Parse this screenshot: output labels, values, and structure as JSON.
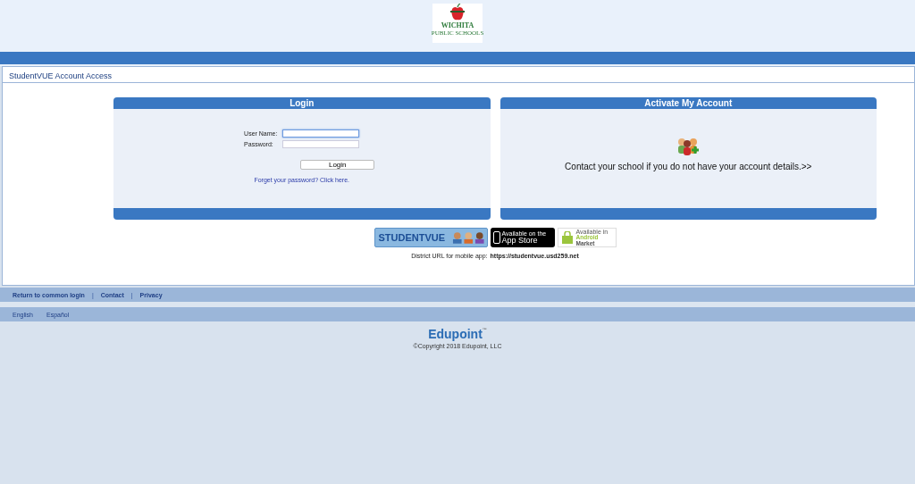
{
  "logo": {
    "name": "WICHITA",
    "subtitle": "PUBLIC SCHOOLS"
  },
  "page_title": "StudentVUE Account Access",
  "login": {
    "title": "Login",
    "fields": [
      {
        "label": "User Name:",
        "focused": true
      },
      {
        "label": "Password:",
        "focused": false
      }
    ],
    "button": "Login",
    "forgot_link": "Forget your password? Click here."
  },
  "activate": {
    "title": "Activate My Account",
    "message": "Contact your school if you do not have your account details.>>"
  },
  "badges": {
    "studentvue": "STUDENTVUE",
    "app_store": {
      "small": "Available on the",
      "large": "App Store"
    },
    "android": {
      "small": "Available in",
      "line1": "Android",
      "line2": "Market"
    }
  },
  "district_url": {
    "label": "District URL for mobile app:",
    "url": "https://studentvue.usd259.net"
  },
  "footer_links": [
    "Return to common login",
    "Contact",
    "Privacy"
  ],
  "footer_separators": [
    "|",
    "|"
  ],
  "languages": [
    "English",
    "Español"
  ],
  "brand": {
    "name": "Edupoint",
    "trademark": "™",
    "copyright": "©Copyright 2018 Edupoint, LLC"
  }
}
